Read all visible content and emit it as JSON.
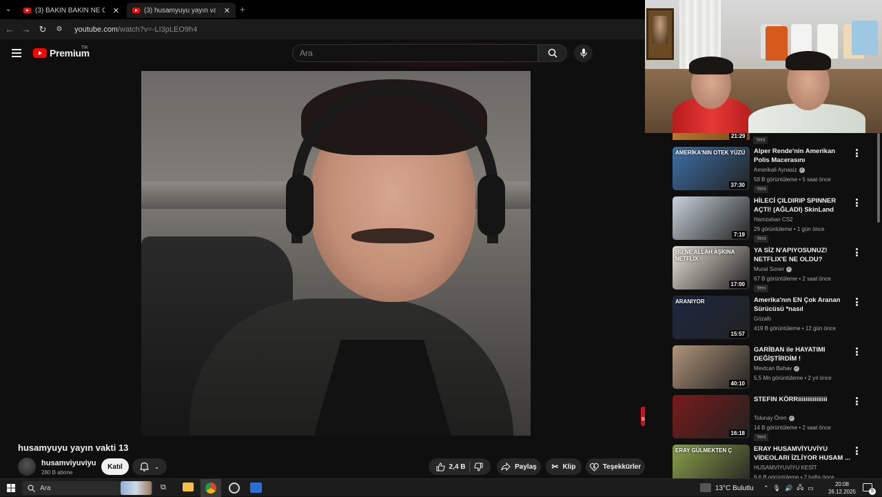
{
  "browser": {
    "tabs": [
      {
        "title": "(3) BAKIN BAKIN NE OLUYOR? |"
      },
      {
        "title": "(3) husamyuyu yayın vakti 13 -"
      }
    ],
    "url_host": "youtube.com",
    "url_rest": "/watch?v=-LI3pLEO9h4"
  },
  "header": {
    "logo": "Premium",
    "logo_region": "TR",
    "search_placeholder": "Ara"
  },
  "player": {
    "subscribe_badge": "SUB SCRIBE"
  },
  "video": {
    "title": "husamyuyu yayın vakti 13",
    "channel": "husamviyuviyu",
    "subscribers": "280 B abone",
    "join": "Katıl",
    "likes": "2,4 B",
    "share": "Paylaş",
    "clip": "Klip",
    "thanks": "Teşekkürler"
  },
  "sidebar": {
    "top_partial": {
      "duration": "21:29",
      "badge": "Yeni"
    },
    "videos": [
      {
        "title": "Alper Rende'nin Amerikan Polis Macerasını Yorumluyorum! ...",
        "channel": "Amerikali Aynasiz",
        "verified": true,
        "meta": "58 B görüntüleme • 5 saat önce",
        "badge": "Yeni",
        "duration": "37:30",
        "thumb_color": "#3d6fa8",
        "thumb_text": "AMERİKA'NIN OTEK YÜZÜ"
      },
      {
        "title": "HİLECİ ÇILDIRIP SPINNER AÇTI! (AĞLADI) SkinLand Promo ...",
        "channel": "Hamzahan CS2",
        "verified": false,
        "meta": "29 görüntüleme • 1 gün önce",
        "badge": "Yeni",
        "duration": "7:19",
        "thumb_color": "#c9d3dc",
        "thumb_text": ""
      },
      {
        "title": "YA SİZ N'APIYOSUNUZ! NETFLIX'E NE OLDU?",
        "channel": "Murat Soner",
        "verified": true,
        "meta": "67 B görüntüleme • 2 saat önce",
        "badge": "Yeni",
        "duration": "17:00",
        "thumb_color": "#e9e2d6",
        "thumb_text": "BU NE ALLAH AŞKINA NETFLIX"
      },
      {
        "title": "Amerika'nın EN Çok Aranan Sürücüsü *nasıl yakalanmıyor?*",
        "channel": "Gözaltı",
        "verified": false,
        "meta": "419 B görüntüleme • 12 gün önce",
        "badge": "",
        "duration": "15:57",
        "thumb_color": "#1c2740",
        "thumb_text": "ARANIYOR"
      },
      {
        "title": "GARİBAN ile HAYATIMI DEĞİŞTİRDİM !",
        "channel": "Mevtcan Bahav",
        "verified": true,
        "meta": "5,5 Mn görüntüleme • 2 yıl önce",
        "badge": "",
        "duration": "40:10",
        "thumb_color": "#b09478",
        "thumb_text": ""
      },
      {
        "title": "STEFIN KÖRRiiiiiiiiiiiiiiii",
        "channel": "Tolunay Ören",
        "verified": true,
        "meta": "14 B görüntüleme • 2 saat önce",
        "badge": "Yeni",
        "duration": "16:18",
        "thumb_color": "#7a1a1a",
        "thumb_text": ""
      },
      {
        "title": "ERAY HUSAMVİYUVİYU VİDEOLARI İZLİYOR HUSAM ...",
        "channel": "HUSAMVİYUVİYU KESİT",
        "verified": false,
        "meta": "9,6 B görüntüleme • 2 hafta önce",
        "badge": "",
        "duration": "12:51",
        "thumb_color": "#8aa04a",
        "thumb_text": "ERAY GÜLMEKTEN Ç"
      }
    ]
  },
  "taskbar": {
    "search": "Ara",
    "weather": "13°C  Bulutlu",
    "time": "20:08",
    "date": "26.12.2025",
    "notifications": "5"
  }
}
